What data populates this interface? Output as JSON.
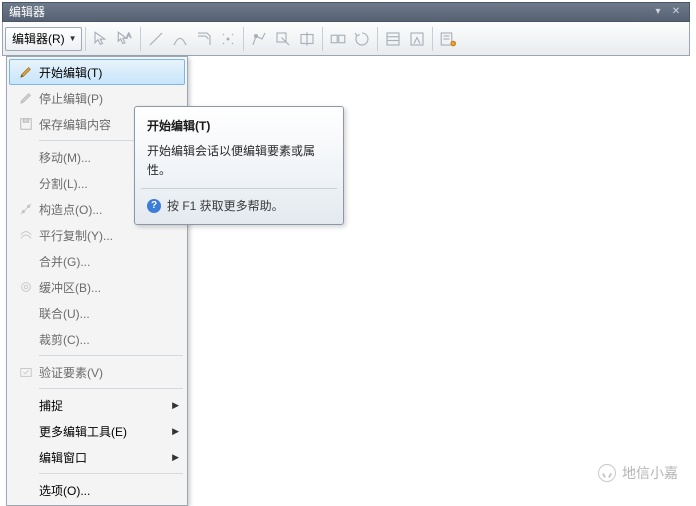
{
  "panel": {
    "title": "编辑器"
  },
  "toolbar": {
    "dropdown_label": "编辑器(R)"
  },
  "menu": {
    "start_edit": "开始编辑(T)",
    "stop_edit": "停止编辑(P)",
    "save_edits": "保存编辑内容",
    "move": "移动(M)...",
    "split": "分割(L)...",
    "construct_pts": "构造点(O)...",
    "parallel_copy": "平行复制(Y)...",
    "merge": "合并(G)...",
    "buffer": "缓冲区(B)...",
    "union": "联合(U)...",
    "clip": "裁剪(C)...",
    "validate": "验证要素(V)",
    "snap": "捕捉",
    "more_tools": "更多编辑工具(E)",
    "edit_window": "编辑窗口",
    "options": "选项(O)..."
  },
  "tooltip": {
    "title": "开始编辑(T)",
    "body": "开始编辑会话以便编辑要素或属性。",
    "help": "按 F1 获取更多帮助。"
  },
  "watermark": {
    "text": "地信小嘉"
  }
}
